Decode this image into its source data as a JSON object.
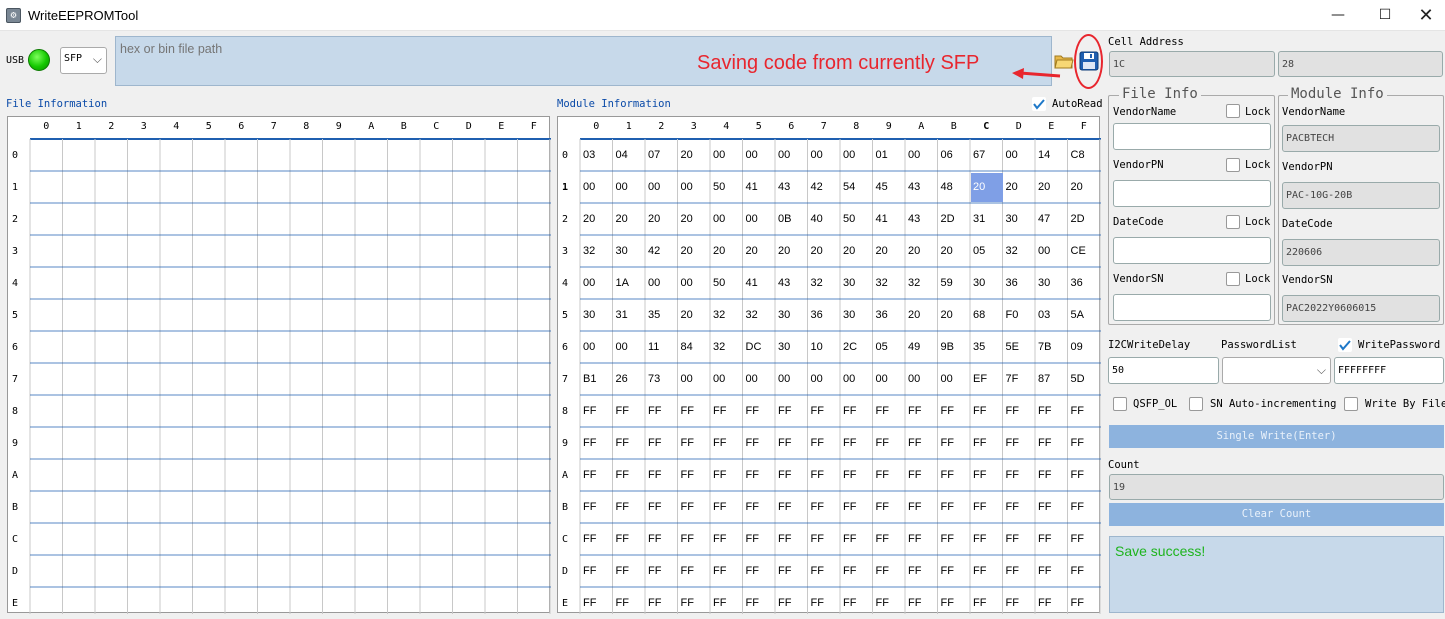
{
  "window": {
    "title": "WriteEEPROMTool"
  },
  "usb_label": "USB",
  "module_type": "SFP",
  "file_path": {
    "placeholder": "hex or bin file path",
    "value": ""
  },
  "annotation": "Saving code from currently SFP",
  "file_info_title": "File Information",
  "module_info_title": "Module Information",
  "autoread_label": "AutoRead",
  "col_headers": [
    "0",
    "1",
    "2",
    "3",
    "4",
    "5",
    "6",
    "7",
    "8",
    "9",
    "A",
    "B",
    "C",
    "D",
    "E",
    "F"
  ],
  "row_headers": [
    "0",
    "1",
    "2",
    "3",
    "4",
    "5",
    "6",
    "7",
    "8",
    "9",
    "A",
    "B",
    "C",
    "D",
    "E"
  ],
  "module_rows": [
    [
      "03",
      "04",
      "07",
      "20",
      "00",
      "00",
      "00",
      "00",
      "00",
      "01",
      "00",
      "06",
      "67",
      "00",
      "14",
      "C8"
    ],
    [
      "00",
      "00",
      "00",
      "00",
      "50",
      "41",
      "43",
      "42",
      "54",
      "45",
      "43",
      "48",
      "20",
      "20",
      "20",
      "20"
    ],
    [
      "20",
      "20",
      "20",
      "20",
      "00",
      "00",
      "0B",
      "40",
      "50",
      "41",
      "43",
      "2D",
      "31",
      "30",
      "47",
      "2D"
    ],
    [
      "32",
      "30",
      "42",
      "20",
      "20",
      "20",
      "20",
      "20",
      "20",
      "20",
      "20",
      "20",
      "05",
      "32",
      "00",
      "CE"
    ],
    [
      "00",
      "1A",
      "00",
      "00",
      "50",
      "41",
      "43",
      "32",
      "30",
      "32",
      "32",
      "59",
      "30",
      "36",
      "30",
      "36"
    ],
    [
      "30",
      "31",
      "35",
      "20",
      "32",
      "32",
      "30",
      "36",
      "30",
      "36",
      "20",
      "20",
      "68",
      "F0",
      "03",
      "5A"
    ],
    [
      "00",
      "00",
      "11",
      "84",
      "32",
      "DC",
      "30",
      "10",
      "2C",
      "05",
      "49",
      "9B",
      "35",
      "5E",
      "7B",
      "09"
    ],
    [
      "B1",
      "26",
      "73",
      "00",
      "00",
      "00",
      "00",
      "00",
      "00",
      "00",
      "00",
      "00",
      "EF",
      "7F",
      "87",
      "5D"
    ],
    [
      "FF",
      "FF",
      "FF",
      "FF",
      "FF",
      "FF",
      "FF",
      "FF",
      "FF",
      "FF",
      "FF",
      "FF",
      "FF",
      "FF",
      "FF",
      "FF"
    ],
    [
      "FF",
      "FF",
      "FF",
      "FF",
      "FF",
      "FF",
      "FF",
      "FF",
      "FF",
      "FF",
      "FF",
      "FF",
      "FF",
      "FF",
      "FF",
      "FF"
    ],
    [
      "FF",
      "FF",
      "FF",
      "FF",
      "FF",
      "FF",
      "FF",
      "FF",
      "FF",
      "FF",
      "FF",
      "FF",
      "FF",
      "FF",
      "FF",
      "FF"
    ],
    [
      "FF",
      "FF",
      "FF",
      "FF",
      "FF",
      "FF",
      "FF",
      "FF",
      "FF",
      "FF",
      "FF",
      "FF",
      "FF",
      "FF",
      "FF",
      "FF"
    ],
    [
      "FF",
      "FF",
      "FF",
      "FF",
      "FF",
      "FF",
      "FF",
      "FF",
      "FF",
      "FF",
      "FF",
      "FF",
      "FF",
      "FF",
      "FF",
      "FF"
    ],
    [
      "FF",
      "FF",
      "FF",
      "FF",
      "FF",
      "FF",
      "FF",
      "FF",
      "FF",
      "FF",
      "FF",
      "FF",
      "FF",
      "FF",
      "FF",
      "FF"
    ],
    [
      "FF",
      "FF",
      "FF",
      "FF",
      "FF",
      "FF",
      "FF",
      "FF",
      "FF",
      "FF",
      "FF",
      "FF",
      "FF",
      "FF",
      "FF",
      "FF"
    ]
  ],
  "cell_address": {
    "label": "Cell Address",
    "address": "1C",
    "value": "28"
  },
  "file_info": {
    "title": "File Info",
    "lock_label": "Lock",
    "vendor_name_label": "VendorName",
    "vendor_pn_label": "VendorPN",
    "date_code_label": "DateCode",
    "vendor_sn_label": "VendorSN"
  },
  "module_info": {
    "title": "Module Info",
    "vendor_name_label": "VendorName",
    "vendor_name": "PACBTECH",
    "vendor_pn_label": "VendorPN",
    "vendor_pn": "PAC-10G-20B",
    "date_code_label": "DateCode",
    "date_code": "220606",
    "vendor_sn_label": "VendorSN",
    "vendor_sn": "PAC2022Y0606015"
  },
  "i2c_write_delay": {
    "label": "I2CWriteDelay",
    "value": "50"
  },
  "password_list_label": "PasswordList",
  "write_password": {
    "label": "WritePassword",
    "value": "FFFFFFFF"
  },
  "options": {
    "qsfp_ol": "QSFP_OL",
    "sn_auto": "SN Auto-incrementing",
    "write_by_file": "Write By File"
  },
  "single_write_label": "Single Write(Enter)",
  "count": {
    "label": "Count",
    "value": "19"
  },
  "clear_count_label": "Clear Count",
  "status_message": "Save success!",
  "colors": {
    "accent": "#1e78c8",
    "status_ok": "#1eb41e",
    "annotation": "#e8262e",
    "selected_cell": "#7f9fe6"
  }
}
